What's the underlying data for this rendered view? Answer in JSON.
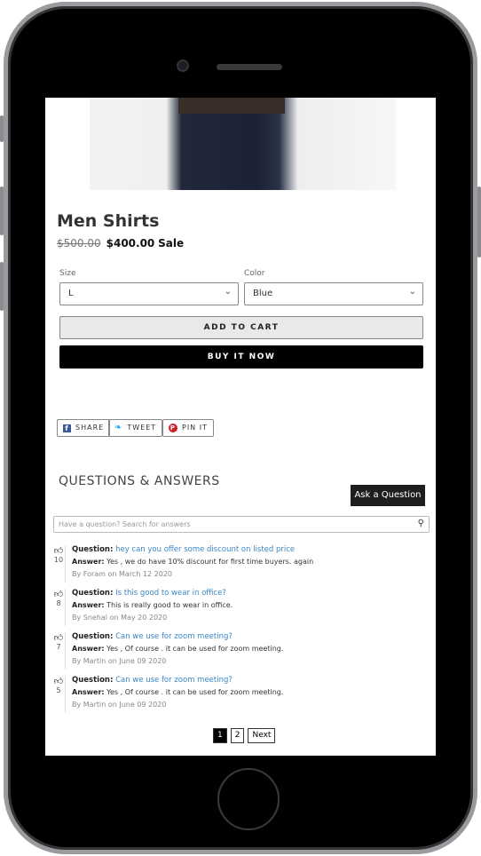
{
  "product": {
    "title": "Men Shirts",
    "old_price": "$500.00",
    "price": "$400.00",
    "sale_label": "Sale"
  },
  "options": {
    "size_label": "Size",
    "size_value": "L",
    "color_label": "Color",
    "color_value": "Blue"
  },
  "buttons": {
    "add_to_cart": "ADD TO CART",
    "buy_now": "BUY IT NOW"
  },
  "share": [
    {
      "label": "SHARE",
      "icon": "facebook-icon",
      "color": "#3b5998"
    },
    {
      "label": "TWEET",
      "icon": "twitter-icon",
      "color": "#1da1f2"
    },
    {
      "label": "PIN IT",
      "icon": "pinterest-icon",
      "color": "#cb2027"
    }
  ],
  "qa": {
    "title": "QUESTIONS & ANSWERS",
    "ask_button": "Ask a Question",
    "search_placeholder": "Have a question? Search for answers",
    "question_label": "Question:",
    "answer_label": "Answer:",
    "items": [
      {
        "votes": "10",
        "question": "hey can you offer some discount on listed price",
        "answer": "Yes , we do have 10% discount for first time buyers. again",
        "by": "By Foram on March 12 2020"
      },
      {
        "votes": "8",
        "question": "Is this good to wear in office?",
        "answer": "This is really good to wear in office.",
        "by": "By Snehal on May 20 2020"
      },
      {
        "votes": "7",
        "question": "Can we use for zoom meeting?",
        "answer": "Yes , Of course . it can be used for zoom meeting.",
        "by": "By Martin on June 09 2020"
      },
      {
        "votes": "5",
        "question": "Can we use for zoom meeting?",
        "answer": "Yes , Of course . it can be used for zoom meeting.",
        "by": "By Martin on June 09 2020"
      }
    ]
  },
  "pagination": {
    "pages": [
      "1",
      "2"
    ],
    "current": "1",
    "next": "Next"
  }
}
